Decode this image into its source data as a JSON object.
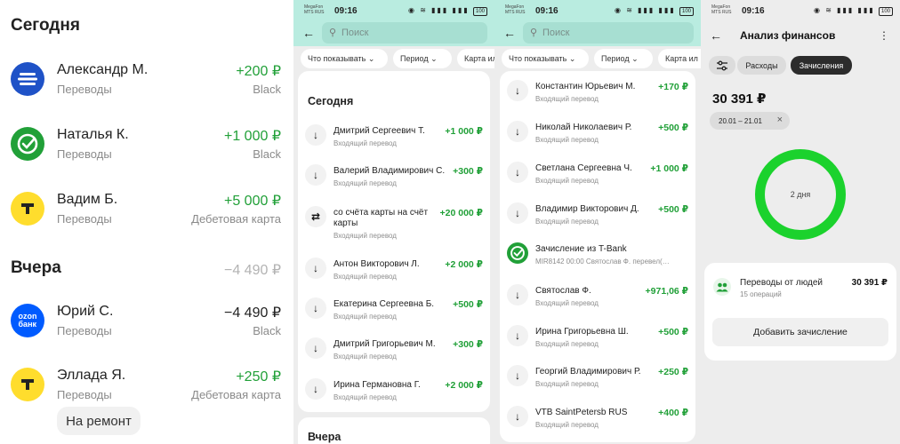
{
  "panel1": {
    "today_heading": "Сегодня",
    "yesterday_heading": "Вчера",
    "yesterday_total": "−4 490 ₽",
    "today": [
      {
        "name": "Александр М.",
        "category": "Переводы",
        "amount": "+200 ₽",
        "account": "Black",
        "avatar": "sber-like-icon",
        "color": "#1f52c7"
      },
      {
        "name": "Наталья К.",
        "category": "Переводы",
        "amount": "+1 000 ₽",
        "account": "Black",
        "avatar": "sber-check-icon",
        "color": "#21a038"
      },
      {
        "name": "Вадим Б.",
        "category": "Переводы",
        "amount": "+5 000 ₽",
        "account": "Дебетовая карта",
        "avatar": "tbank-icon",
        "color": "#ffdd2d"
      }
    ],
    "yesterday": [
      {
        "name": "Юрий С.",
        "category": "Переводы",
        "amount": "−4 490 ₽",
        "account": "Black",
        "avatar": "ozon-bank-icon",
        "color": "#005bff",
        "avatar_text": "ozon\nбанк"
      },
      {
        "name": "Эллада Я.",
        "category": "Переводы",
        "amount": "+250 ₽",
        "account": "Дебетовая карта",
        "avatar": "tbank-icon",
        "color": "#ffdd2d"
      }
    ],
    "chip": "На ремонт"
  },
  "status": {
    "carrier_line1": "MegaFon",
    "carrier_line2": "MTS RUS",
    "time": "09:16",
    "battery": "100"
  },
  "search_panel": {
    "placeholder": "Поиск",
    "filter_show": "Что показывать",
    "filter_period": "Период",
    "filter_cards": "Карта ил"
  },
  "panel2": {
    "today_heading": "Сегодня",
    "yesterday_heading": "Вчера",
    "rows": [
      {
        "name": "Дмитрий Сергеевич Т.",
        "sub": "Входящий перевод",
        "amount": "+1 000 ₽",
        "icon": "arrow-down-icon"
      },
      {
        "name": "Валерий Владимирович С.",
        "sub": "Входящий перевод",
        "amount": "+300 ₽",
        "icon": "arrow-down-icon"
      },
      {
        "name": "со счёта карты на счёт карты",
        "sub": "Входящий перевод",
        "amount": "+20 000 ₽",
        "icon": "exchange-icon"
      },
      {
        "name": "Антон Викторович Л.",
        "sub": "Входящий перевод",
        "amount": "+2 000 ₽",
        "icon": "arrow-down-icon"
      },
      {
        "name": "Екатерина Сергеевна Б.",
        "sub": "Входящий перевод",
        "amount": "+500 ₽",
        "icon": "arrow-down-icon"
      },
      {
        "name": "Дмитрий Григорьевич М.",
        "sub": "Входящий перевод",
        "amount": "+300 ₽",
        "icon": "arrow-down-icon"
      },
      {
        "name": "Ирина Германовна Г.",
        "sub": "Входящий перевод",
        "amount": "+2 000 ₽",
        "icon": "arrow-down-icon"
      }
    ]
  },
  "panel3": {
    "rows": [
      {
        "name": "Константин Юрьевич М.",
        "sub": "Входящий перевод",
        "amount": "+170 ₽",
        "icon": "arrow-down-icon"
      },
      {
        "name": "Николай Николаевич Р.",
        "sub": "Входящий перевод",
        "amount": "+500 ₽",
        "icon": "arrow-down-icon"
      },
      {
        "name": "Светлана Сергеевна Ч.",
        "sub": "Входящий перевод",
        "amount": "+1 000 ₽",
        "icon": "arrow-down-icon"
      },
      {
        "name": "Владимир Викторович Д.",
        "sub": "Входящий перевод",
        "amount": "+500 ₽",
        "icon": "arrow-down-icon"
      },
      {
        "name": "Зачисление из T-Bank",
        "sub": "MIR8142 00:00 Святослав Ф. перевел(…",
        "amount": "",
        "icon": "sber-check-icon"
      },
      {
        "name": "Святослав Ф.",
        "sub": "Входящий перевод",
        "amount": "+971,06 ₽",
        "icon": "arrow-down-icon"
      },
      {
        "name": "Ирина Григорьевна Ш.",
        "sub": "Входящий перевод",
        "amount": "+500 ₽",
        "icon": "arrow-down-icon"
      },
      {
        "name": "Георгий Владимирович Р.",
        "sub": "Входящий перевод",
        "amount": "+250 ₽",
        "icon": "arrow-down-icon"
      },
      {
        "name": "VTB SaintPetersb RUS",
        "sub": "Входящий перевод",
        "amount": "+400 ₽",
        "icon": "arrow-down-icon"
      }
    ]
  },
  "panel4": {
    "title": "Анализ финансов",
    "tab_expenses": "Расходы",
    "tab_income": "Зачисления",
    "total": "30 391 ₽",
    "date_range": "20.01 – 21.01",
    "ring_label": "2 дня",
    "category": "Переводы от людей",
    "category_count": "15 операций",
    "category_amount": "30 391 ₽",
    "add_button": "Добавить зачисление",
    "accent": "#1bd22d"
  }
}
